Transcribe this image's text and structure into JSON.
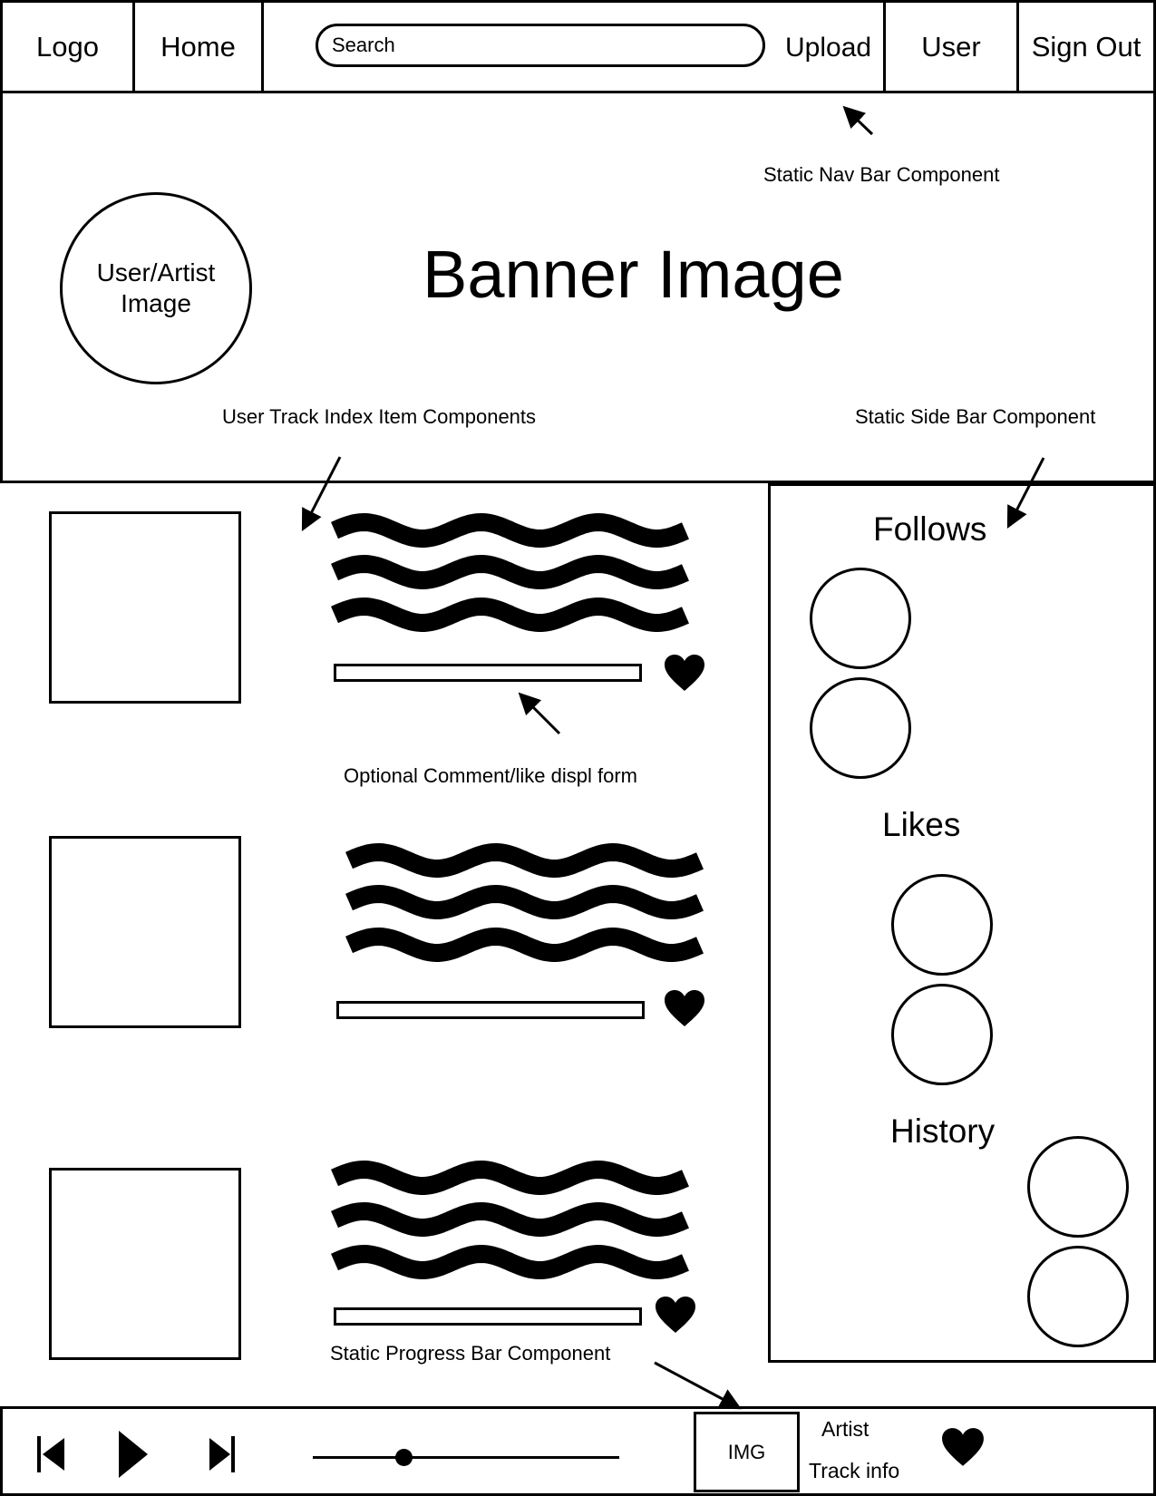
{
  "nav": {
    "logo": "Logo",
    "home": "Home",
    "search_placeholder": "Search",
    "upload": "Upload",
    "user": "User",
    "sign_out": "Sign Out"
  },
  "banner": {
    "title": "Banner Image",
    "avatar_label_line1": "User/Artist",
    "avatar_label_line2": "Image"
  },
  "annotations": {
    "nav": "Static Nav Bar Component",
    "track_items": "User Track Index Item Components",
    "side_bar": "Static Side Bar Component",
    "comment_form": "Optional Comment/like displ form",
    "progress_bar": "Static Progress Bar Component"
  },
  "sidebar": {
    "follows": "Follows",
    "likes": "Likes",
    "history": "History"
  },
  "player": {
    "img": "IMG",
    "artist": "Artist",
    "track_info": "Track info",
    "volume_fraction": 0.3
  },
  "icons": [
    "skip-back-icon",
    "play-icon",
    "skip-forward-icon",
    "heart-icon"
  ]
}
